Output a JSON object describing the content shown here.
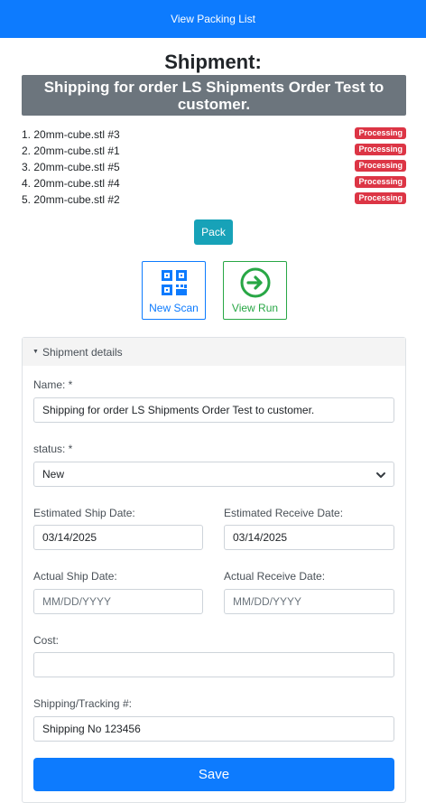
{
  "topbar": {
    "link": "View Packing List"
  },
  "page": {
    "title": "Shipment:",
    "subtitle": "Shipping for order LS Shipments Order Test to customer."
  },
  "items": [
    {
      "num": "1.",
      "name": "20mm-cube.stl #3",
      "status": "Processing"
    },
    {
      "num": "2.",
      "name": "20mm-cube.stl #1",
      "status": "Processing"
    },
    {
      "num": "3.",
      "name": "20mm-cube.stl #5",
      "status": "Processing"
    },
    {
      "num": "4.",
      "name": "20mm-cube.stl #4",
      "status": "Processing"
    },
    {
      "num": "5.",
      "name": "20mm-cube.stl #2",
      "status": "Processing"
    }
  ],
  "actions": {
    "pack": "Pack",
    "new_scan": "New Scan",
    "view_run": "View Run"
  },
  "details": {
    "header": "Shipment details",
    "name_label": "Name: *",
    "name_value": "Shipping for order LS Shipments Order Test to customer.",
    "status_label": "status: *",
    "status_value": "New",
    "est_ship_label": "Estimated Ship Date:",
    "est_ship_value": "03/14/2025",
    "est_receive_label": "Estimated Receive Date:",
    "est_receive_value": "03/14/2025",
    "actual_ship_label": "Actual Ship Date:",
    "actual_ship_placeholder": "MM/DD/YYYY",
    "actual_receive_label": "Actual Receive Date:",
    "actual_receive_placeholder": "MM/DD/YYYY",
    "cost_label": "Cost:",
    "cost_value": "",
    "tracking_label": "Shipping/Tracking #:",
    "tracking_value": "Shipping No 123456",
    "save": "Save"
  },
  "colors": {
    "primary": "#0d7bfe",
    "info": "#17a2b8",
    "success": "#28a745",
    "danger": "#dc3545",
    "secondary": "#6c757d"
  },
  "icons": {
    "new_scan": "qr-code-icon",
    "view_run": "arrow-right-circle-icon",
    "details_caret": "caret-down-icon",
    "select_chevron": "chevron-down-icon"
  }
}
